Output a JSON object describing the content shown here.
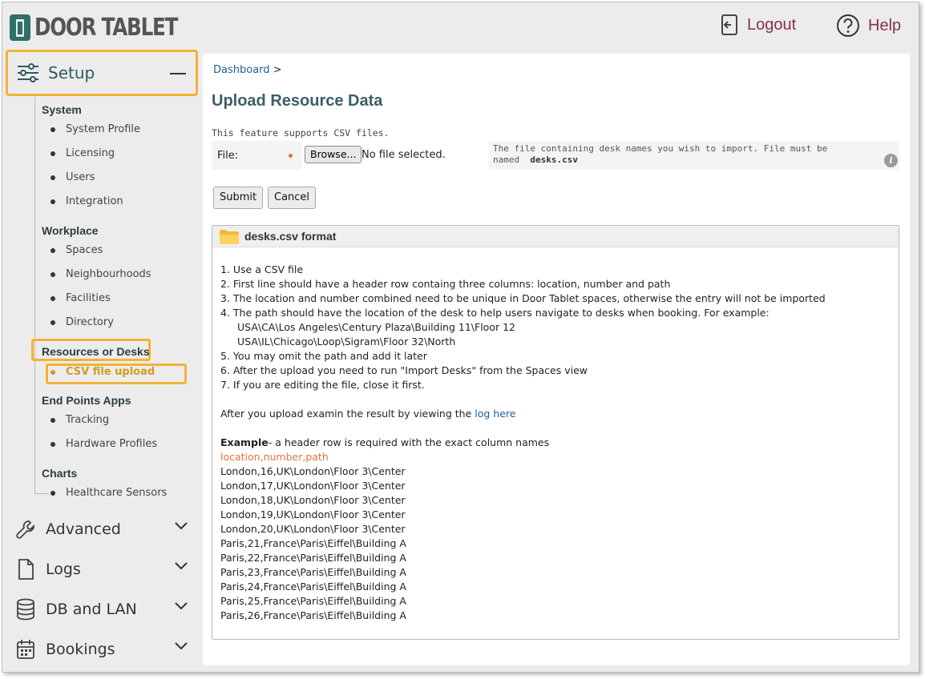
{
  "header": {
    "logo_text": "DOOR TABLET",
    "logout_label": "Logout",
    "help_label": "Help"
  },
  "sidebar": {
    "setup_label": "Setup",
    "groups": [
      {
        "label": "System",
        "items": [
          "System Profile",
          "Licensing",
          "Users",
          "Integration"
        ]
      },
      {
        "label": "Workplace",
        "items": [
          "Spaces",
          "Neighbourhoods",
          "Facilities",
          "Directory"
        ]
      },
      {
        "label": "Resources or Desks",
        "items": [
          "CSV file upload"
        ]
      },
      {
        "label": "End Points Apps",
        "items": [
          "Tracking",
          "Hardware Profiles"
        ]
      },
      {
        "label": "Charts",
        "items": [
          "Healthcare Sensors"
        ]
      }
    ],
    "sections": [
      "Advanced",
      "Logs",
      "DB and LAN",
      "Bookings"
    ]
  },
  "main": {
    "breadcrumb_link": "Dashboard",
    "breadcrumb_sep": ">",
    "title": "Upload Resource Data",
    "feature_note": "This feature supports CSV files.",
    "file_label": "File:",
    "browse_label": "Browse...",
    "no_file": "No file selected.",
    "hint_line1": "The file containing desk names you wish to import. File must be",
    "hint_line2_prefix": "named",
    "hint_file": "desks.csv",
    "info_glyph": "i",
    "submit_label": "Submit",
    "cancel_label": "Cancel"
  },
  "format": {
    "title": "desks.csv format",
    "rules": [
      "1. Use a CSV file",
      "2. First line should have a header row containg three columns: location, number and path",
      "3. The location and number combined need to be unique in Door Tablet spaces, otherwise the entry will not be imported",
      "4. The path should have the location of the desk to help users navigate to desks when booking.  For example:"
    ],
    "examples": [
      "USA\\CA\\Los Angeles\\Century Plaza\\Building 11\\Floor 12",
      "USA\\IL\\Chicago\\Loop\\Sigram\\Floor 32\\North"
    ],
    "rules2": [
      "5. You may omit the path and add it later",
      "6. After the upload you need to run \"Import Desks\" from the Spaces view",
      "7. If you are editing the file, close it first."
    ],
    "log_prefix": "After you upload examin the result by viewing the ",
    "log_link": "log here",
    "example_bold": "Example",
    "example_rest": "- a header row is required with the exact column names",
    "header_row": "location,number,path",
    "rows": [
      "London,16,UK\\London\\Floor 3\\Center",
      "London,17,UK\\London\\Floor 3\\Center",
      "London,18,UK\\London\\Floor 3\\Center",
      "London,19,UK\\London\\Floor 3\\Center",
      "London,20,UK\\London\\Floor 3\\Center",
      "Paris,21,France\\Paris\\Eiffel\\Building A",
      "Paris,22,France\\Paris\\Eiffel\\Building A",
      "Paris,23,France\\Paris\\Eiffel\\Building A",
      "Paris,24,France\\Paris\\Eiffel\\Building A",
      "Paris,25,France\\Paris\\Eiffel\\Building A",
      "Paris,26,France\\Paris\\Eiffel\\Building A"
    ]
  },
  "colors": {
    "accent_highlight": "#f2b233",
    "link": "#1e5d9c",
    "header_link": "#8a2d4f",
    "title": "#3c5f64",
    "csv_header": "#e0743a"
  }
}
